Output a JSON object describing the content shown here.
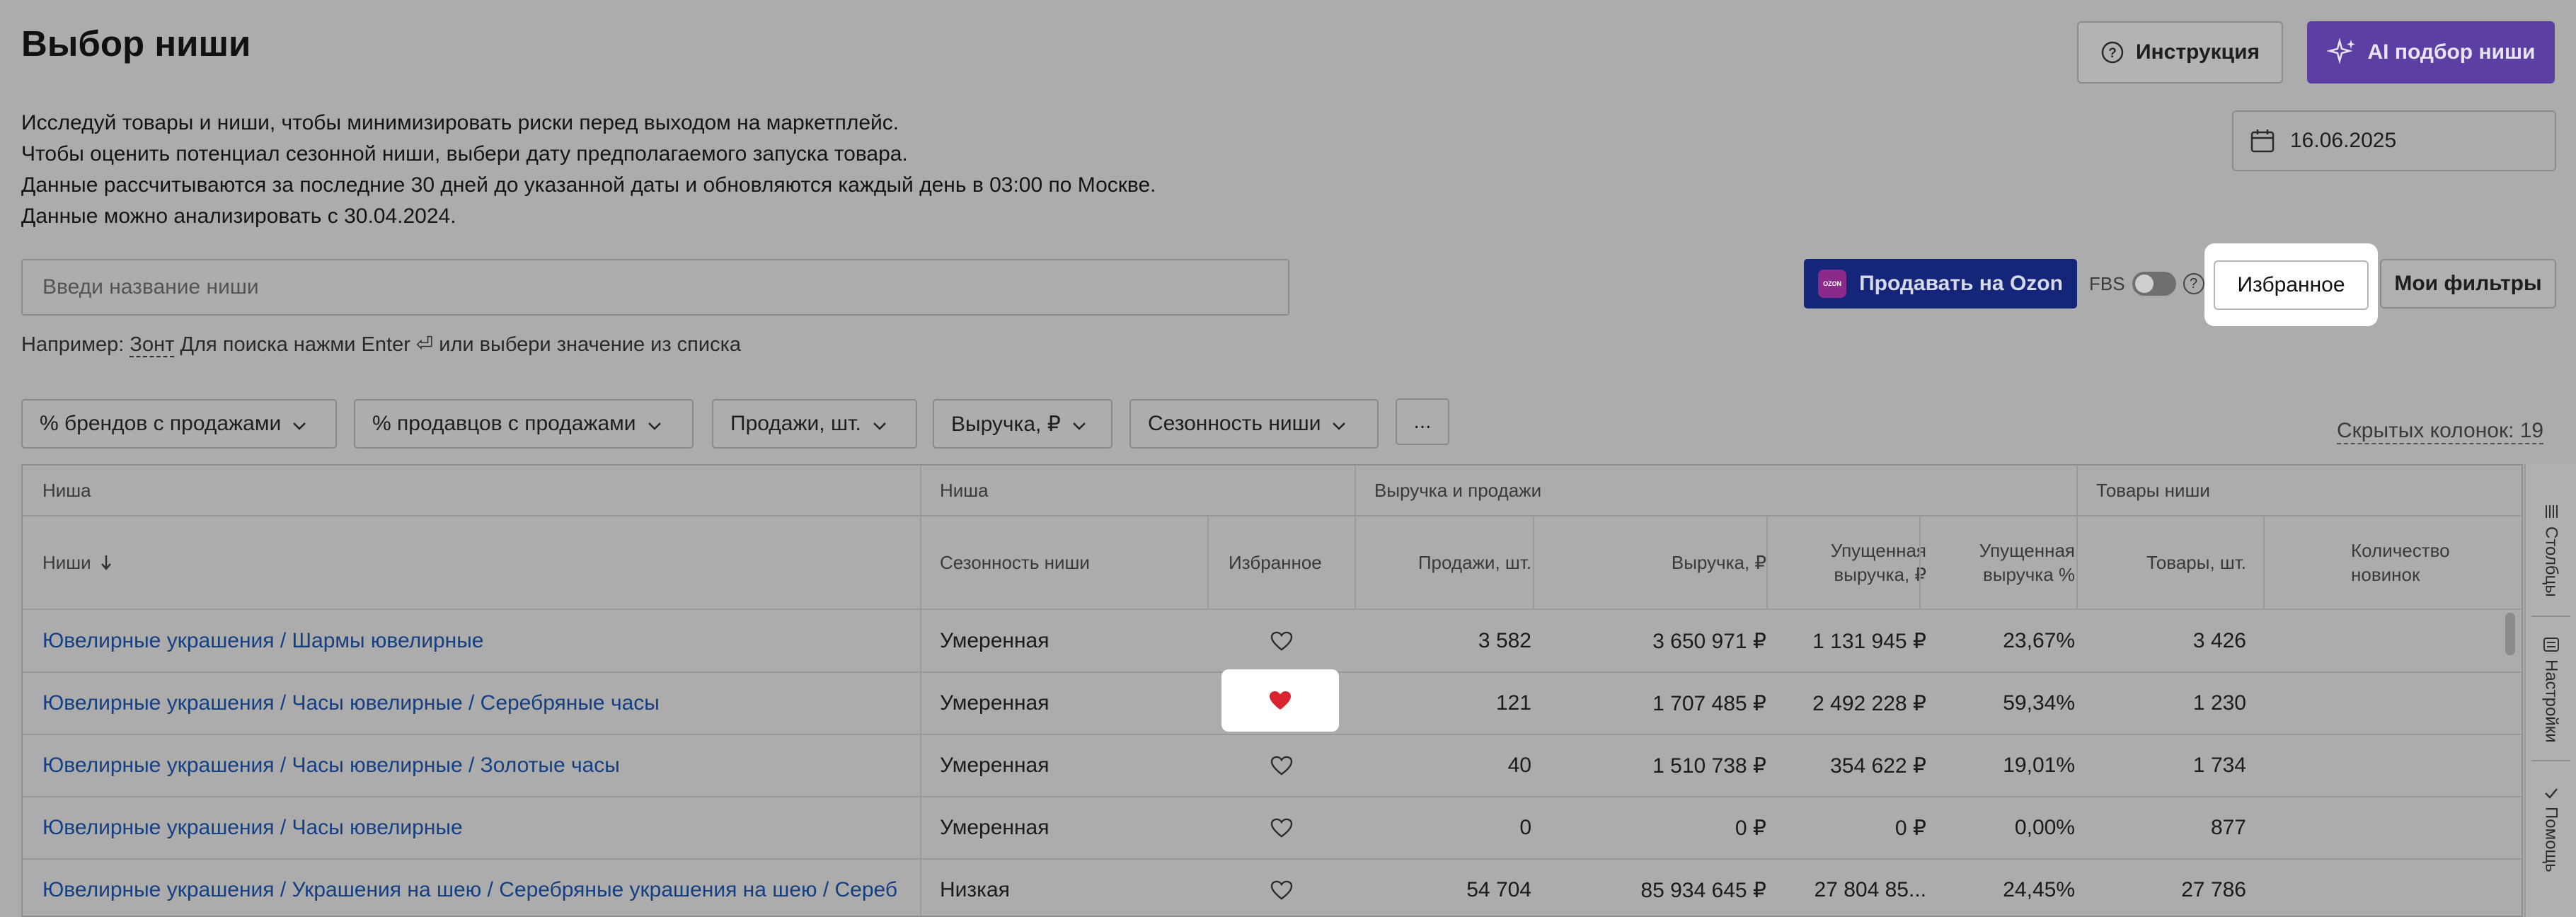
{
  "page": {
    "title": "Выбор ниши",
    "description": [
      "Исследуй товары и ниши, чтобы минимизировать риски перед выходом на маркетплейс.",
      "Чтобы оценить потенциал сезонной ниши, выбери дату предполагаемого запуска товара.",
      "Данные рассчитываются за последние 30 дней до указанной даты и обновляются каждый день в 03:00 по Москве.",
      "Данные можно анализировать с 30.04.2024."
    ]
  },
  "header": {
    "instruction_label": "Инструкция",
    "ai_label": "AI подбор ниши",
    "date_value": "16.06.2025"
  },
  "search": {
    "placeholder": "Введи название ниши",
    "hint_prefix": "Например:",
    "hint_example": "Зонт",
    "hint_suffix": "Для поиска нажми Enter ⏎ или выбери значение из списка"
  },
  "actions": {
    "ozon_label": "Продавать на Ozon",
    "ozon_logo": "OZON",
    "fbs_label": "FBS",
    "fbs_enabled": false,
    "favorites_label": "Избранное",
    "my_filters_label": "Мои фильтры"
  },
  "filters": {
    "chips": [
      "% брендов с продажами",
      "% продавцов с продажами",
      "Продажи, шт.",
      "Выручка, ₽",
      "Сезонность ниши"
    ],
    "more_label": "...",
    "hidden_columns": "Скрытых колонок: 19"
  },
  "table": {
    "groups": [
      "Ниша",
      "Ниша",
      "Выручка и продажи",
      "Товары ниши"
    ],
    "columns": {
      "niche": "Ниши",
      "seasonality": "Сезонность ниши",
      "favorite": "Избранное",
      "sales": "Продажи, шт.",
      "revenue": "Выручка, ₽",
      "lost_revenue_line1": "Упущенная",
      "lost_revenue_line2": "выручка, ₽",
      "lost_pct_line1": "Упущенная",
      "lost_pct_line2": "выручка %",
      "goods": "Товары, шт.",
      "new_count": "Количество новинок"
    },
    "rows": [
      {
        "niche": "Ювелирные украшения / Шармы ювелирные",
        "seasonality": "Умеренная",
        "favorite": false,
        "sales": "3 582",
        "revenue": "3 650 971 ₽",
        "lost_revenue": "1 131 945 ₽",
        "lost_pct": "23,67%",
        "goods": "3 426"
      },
      {
        "niche": "Ювелирные украшения / Часы ювелирные / Серебряные часы",
        "seasonality": "Умеренная",
        "favorite": true,
        "sales": "121",
        "revenue": "1 707 485 ₽",
        "lost_revenue": "2 492 228 ₽",
        "lost_pct": "59,34%",
        "goods": "1 230"
      },
      {
        "niche": "Ювелирные украшения / Часы ювелирные / Золотые часы",
        "seasonality": "Умеренная",
        "favorite": false,
        "sales": "40",
        "revenue": "1 510 738 ₽",
        "lost_revenue": "354 622 ₽",
        "lost_pct": "19,01%",
        "goods": "1 734"
      },
      {
        "niche": "Ювелирные украшения / Часы ювелирные",
        "seasonality": "Умеренная",
        "favorite": false,
        "sales": "0",
        "revenue": "0 ₽",
        "lost_revenue": "0 ₽",
        "lost_pct": "0,00%",
        "goods": "877"
      },
      {
        "niche": "Ювелирные украшения / Украшения на шею / Серебряные украшения на шею / Сереб",
        "seasonality": "Низкая",
        "favorite": false,
        "sales": "54 704",
        "revenue": "85 934 645 ₽",
        "lost_revenue": "27 804 85...",
        "lost_pct": "24,45%",
        "goods": "27 786"
      }
    ]
  },
  "side_panel": {
    "tabs": [
      "Столбцы",
      "Настройки",
      "Помощь"
    ]
  },
  "colors": {
    "overlay_bg": "#acacac",
    "ai_button": "#5c3fa3",
    "ozon_button": "#15267a",
    "link": "#153f80",
    "heart_active": "#d9232e"
  }
}
